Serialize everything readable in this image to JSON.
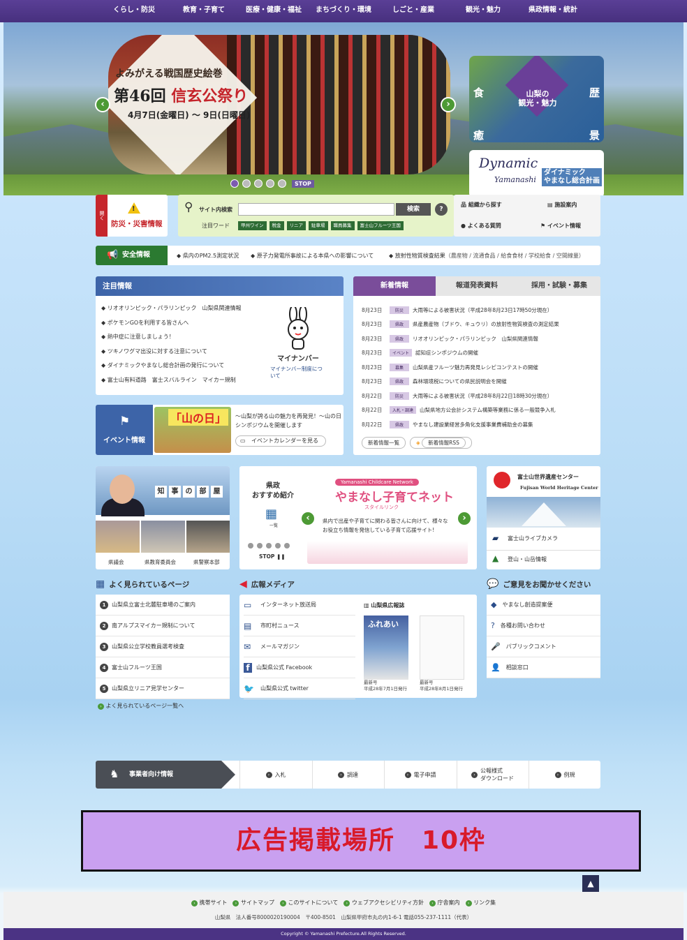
{
  "nav": [
    "くらし・防災",
    "教育・子育て",
    "医療・健康・福祉",
    "まちづくり・環境",
    "しごと・産業",
    "観光・魅力",
    "県政情報・統計"
  ],
  "hero": {
    "subtitle": "よみがえる戦国歴史絵巻",
    "title_prefix": "第46回",
    "title_main": "信玄公祭り",
    "date": "4月7日(金曜日) ～ 9日(日曜日)",
    "stop": "STOP",
    "slide_count": 5,
    "active_slide": 1,
    "side_banner": {
      "label": "山梨の\n観光・魅力",
      "corners": [
        "食",
        "歴",
        "癒",
        "景"
      ]
    },
    "dynamic": {
      "logo_top": "Dynamic",
      "logo_bottom": "Yamanashi",
      "jp": "ダイナミック\nやまなし総合計画"
    }
  },
  "bousai": {
    "tab": "開く",
    "label": "防災・災害情報"
  },
  "search": {
    "label": "サイト内検索",
    "button": "検索",
    "help": "?",
    "keyword_label": "注目ワード",
    "keywords": [
      "甲州ワイン",
      "税金",
      "リニア",
      "駐車場",
      "職員募集",
      "富士山フルーツ王国"
    ]
  },
  "util": {
    "org": "組織から探す",
    "facility": "施設案内",
    "faq": "よくある質問",
    "event": "イベント情報"
  },
  "safety": {
    "label": "安全情報",
    "items": [
      "県内のPM2.5測定状況",
      "原子力発電所事故による本県への影響について"
    ],
    "rad_label": "放射性物質検査結果",
    "rad_detail": "（農産物 / 流通食品 / 給食食材 / 学校給食 / 空間線量）"
  },
  "attention": {
    "title": "注目情報",
    "items": [
      "リオオリンピック・パラリンピック　山梨県関連情報",
      "ポケモンGOを利用する皆さんへ",
      "熱中症に注意しましょう！",
      "ツキノワグマ出没に対する注意について",
      "ダイナミックやまなし総合計画の発行について",
      "富士山有料道路　富士スバルライン　マイカー規制"
    ],
    "mynumber": {
      "name": "マイナンバー",
      "caption": "マイナンバー制度について"
    }
  },
  "event": {
    "label": "イベント情報",
    "banner": "「山の日」",
    "text": "～山梨が誇る山の魅力を再発見！～山の日シンポジウムを開催します",
    "calendar": "イベントカレンダーを見る"
  },
  "news": {
    "tabs": [
      "新着情報",
      "報道発表資料",
      "採用・試験・募集"
    ],
    "items": [
      {
        "date": "8月23日",
        "cat": "防災",
        "text": "大雨等による被害状況（平成28年8月23日17時50分現在）"
      },
      {
        "date": "8月23日",
        "cat": "県政",
        "text": "県産農産物（ブドウ、キュウリ）の放射性物質検査の測定結果"
      },
      {
        "date": "8月23日",
        "cat": "県政",
        "text": "リオオリンピック・パラリンピック　山梨県関連情報"
      },
      {
        "date": "8月23日",
        "cat": "イベント",
        "text": "認知症シンポジウムの開催"
      },
      {
        "date": "8月23日",
        "cat": "募集",
        "text": "山梨県産フルーツ魅力再発見レシピコンテストの開催"
      },
      {
        "date": "8月23日",
        "cat": "県政",
        "text": "森林環境税についての県民説明会を開催"
      },
      {
        "date": "8月22日",
        "cat": "防災",
        "text": "大雨等による被害状況（平成28年8月22日18時30分現在）"
      },
      {
        "date": "8月22日",
        "cat": "入札・調達",
        "text": "山梨県地方公会計システム構築等業務に係る一般競争入札"
      },
      {
        "date": "8月22日",
        "cat": "県政",
        "text": "やまなし建設業経営多角化支援事業費補助金の募集"
      }
    ],
    "btn_list": "新着情報一覧",
    "btn_rss": "新着情報RSS"
  },
  "governor": {
    "title": [
      "知",
      "事",
      "の",
      "部",
      "屋"
    ],
    "links": [
      "県議会",
      "県教育委員会",
      "県警察本部"
    ]
  },
  "recommend": {
    "title": "県政\nおすすめ紹介",
    "list": "一覧",
    "stop": "STOP",
    "net_label": "Yamanashi Childcare Network",
    "banner_title": "やまなし子育てネット",
    "banner_sub": "スタイルリンク",
    "banner_text": "県内で出産や子育てに関わる皆さんに向けて、様々なお役立ち情報を発信している子育て応援サイト!"
  },
  "fuji": {
    "title": "富士山世界遺産センター",
    "en": "Fujisan World Heritage Center",
    "links": [
      "富士山ライブカメラ",
      "登山・山岳情報"
    ]
  },
  "popular": {
    "title": "よく見られているページ",
    "items": [
      "山梨県立富士北麓駐車場のご案内",
      "南アルプスマイカー規制について",
      "山梨県公立学校教員選考検査",
      "富士山フルーツ王国",
      "山梨県立リニア見学センター"
    ],
    "more": "よく見られているページ一覧へ"
  },
  "media": {
    "title": "広報メディア",
    "items": [
      "インターネット放送局",
      "市町村ニュース",
      "メールマガジン",
      "山梨県公式 Facebook",
      "山梨県公式 twitter"
    ],
    "magazine": "山梨県広報誌",
    "mag1_title": "ふれあい",
    "caps": [
      "最新号\n平成28年7月1日発行",
      "最新号\n平成28年8月1日発行"
    ]
  },
  "opinion": {
    "title": "ご意見をお聞かせください",
    "items": [
      "やまなし創造提案便",
      "各種お問い合わせ",
      "パブリックコメント",
      "相談窓口"
    ]
  },
  "business": {
    "label": "事業者向け情報",
    "items": [
      "入札",
      "調達",
      "電子申請",
      "公報様式\nダウンロード",
      "例規"
    ]
  },
  "ad": "広告掲載場所　10枠",
  "footer": {
    "links": [
      "携帯サイト",
      "サイトマップ",
      "このサイトについて",
      "ウェブアクセシビリティ方針",
      "庁舎案内",
      "リンク集"
    ],
    "address": "山梨県　法人番号8000020190004　〒400-8501　山梨県甲府市丸の内1-6-1 電話055-237-1111（代表）",
    "copyright": "Copyright © Yamanashi Prefecture.All Rights Reserved."
  }
}
